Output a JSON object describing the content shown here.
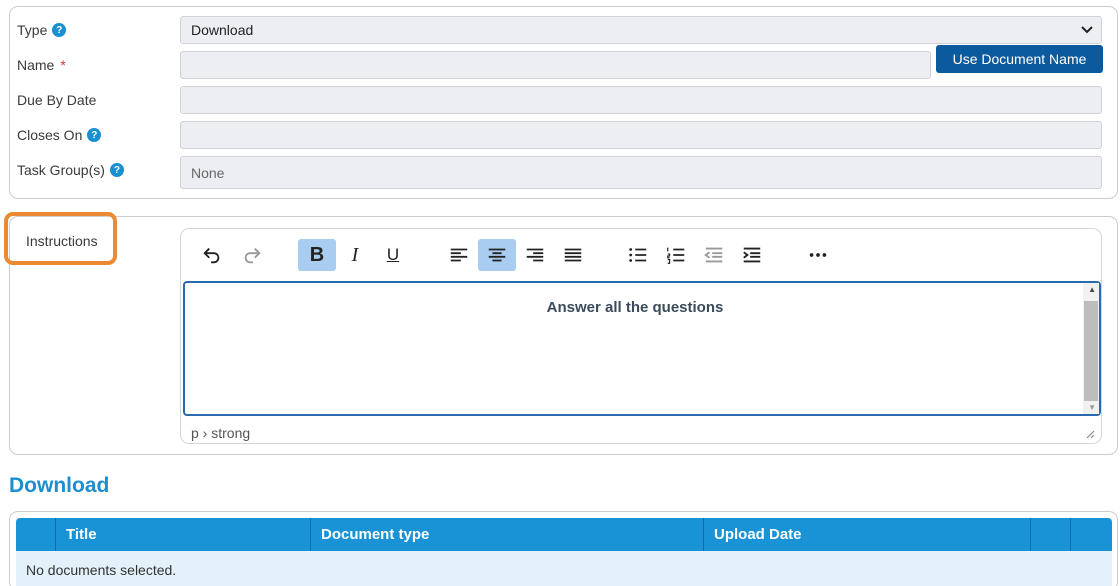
{
  "form": {
    "type": {
      "label": "Type",
      "value": "Download"
    },
    "name": {
      "label": "Name",
      "required_mark": "*",
      "value": "",
      "button_label": "Use Document Name"
    },
    "due_by_date": {
      "label": "Due By Date",
      "value": ""
    },
    "closes_on": {
      "label": "Closes On",
      "value": ""
    },
    "task_groups": {
      "label": "Task Group(s)",
      "placeholder": "None"
    },
    "help_glyph": "?"
  },
  "instructions": {
    "label": "Instructions",
    "content": "Answer all the questions",
    "status_path": "p › strong",
    "toolbar": [
      {
        "name": "undo-icon",
        "state": "normal"
      },
      {
        "name": "redo-icon",
        "state": "disabled"
      },
      {
        "name": "bold-icon",
        "state": "active",
        "glyph": "B"
      },
      {
        "name": "italic-icon",
        "state": "normal",
        "glyph": "I"
      },
      {
        "name": "underline-icon",
        "state": "normal",
        "glyph": "U"
      },
      {
        "name": "align-left-icon",
        "state": "normal"
      },
      {
        "name": "align-center-icon",
        "state": "active"
      },
      {
        "name": "align-right-icon",
        "state": "normal"
      },
      {
        "name": "align-justify-icon",
        "state": "normal"
      },
      {
        "name": "bullet-list-icon",
        "state": "normal"
      },
      {
        "name": "numbered-list-icon",
        "state": "normal"
      },
      {
        "name": "outdent-icon",
        "state": "disabled"
      },
      {
        "name": "indent-icon",
        "state": "normal"
      },
      {
        "name": "more-icon",
        "state": "normal"
      }
    ]
  },
  "download": {
    "title": "Download",
    "columns": [
      "",
      "Title",
      "Document type",
      "Upload Date",
      "",
      ""
    ],
    "empty_message": "No documents selected."
  },
  "colors": {
    "accent": "#1a93d6",
    "button": "#0c5a9e",
    "highlight": "#ec8a33",
    "required": "#d9342b"
  }
}
